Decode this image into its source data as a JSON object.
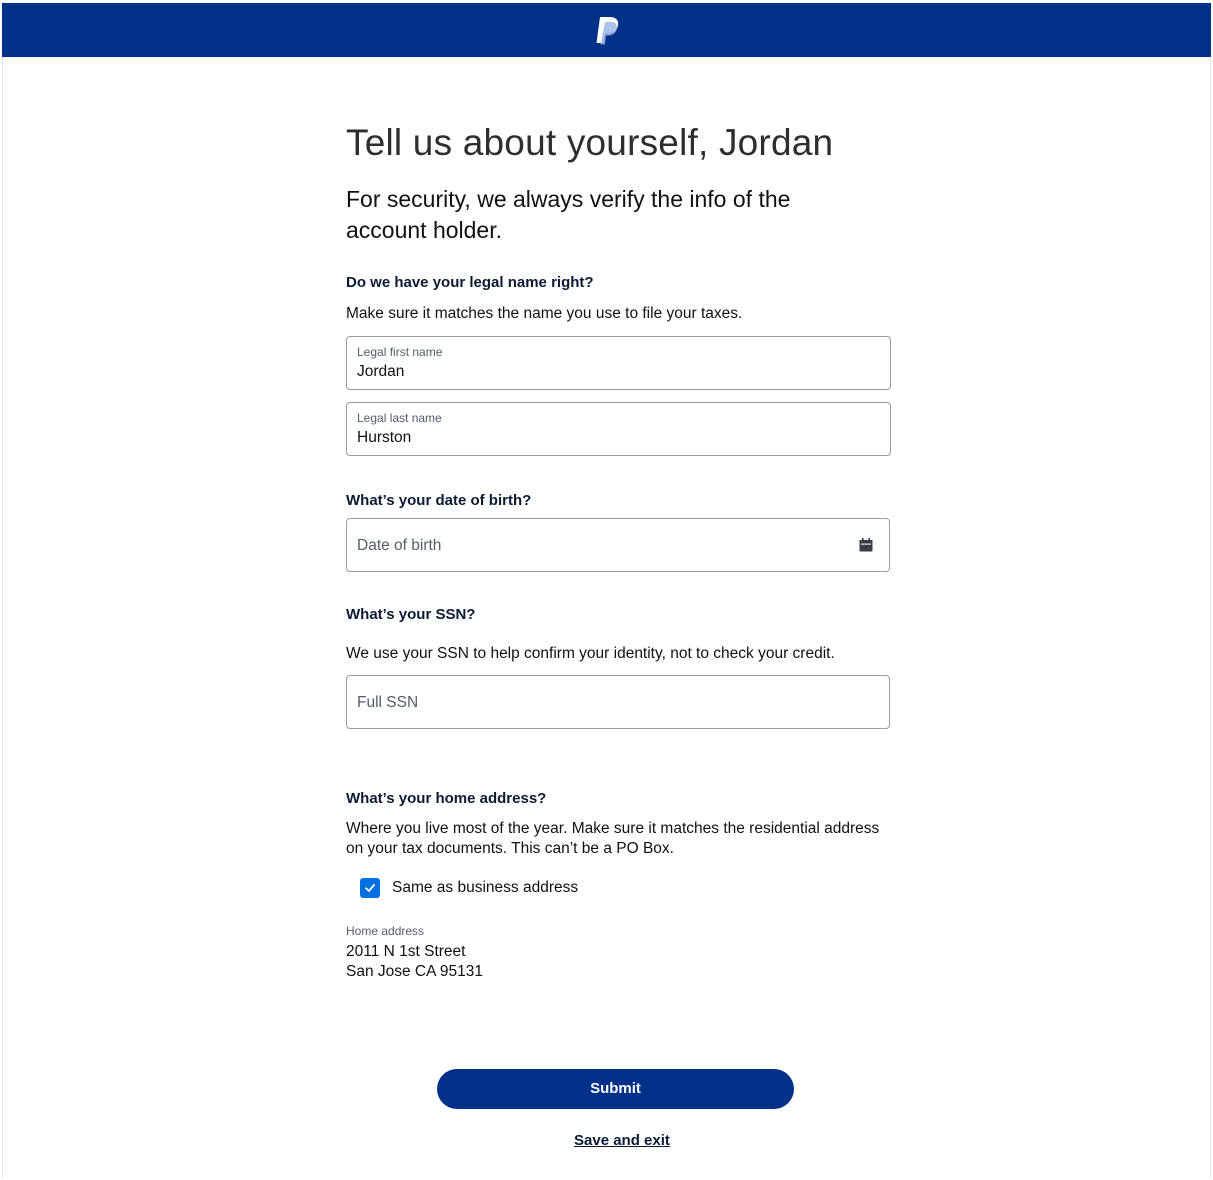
{
  "header": {
    "logo_icon": "paypal-logo-icon",
    "background_color": "#003087"
  },
  "page": {
    "title": "Tell us about yourself, Jordan",
    "subtitle": "For security, we always verify the info of the account holder."
  },
  "legal_name": {
    "heading": "Do we have your legal name right?",
    "description": "Make sure it matches the name you use to file your taxes.",
    "first_name": {
      "label": "Legal first name",
      "value": "Jordan"
    },
    "last_name": {
      "label": "Legal last name",
      "value": "Hurston"
    }
  },
  "dob": {
    "heading": "What’s your date of birth?",
    "placeholder": "Date of birth",
    "icon": "calendar-icon"
  },
  "ssn": {
    "heading": "What’s your SSN?",
    "description": "We use your SSN to help confirm your identity, not to check your credit.",
    "placeholder": "Full SSN"
  },
  "address": {
    "heading": "What’s your home address?",
    "description": "Where you live most of the year. Make sure it matches the residential address on your tax documents. This can’t be a PO Box.",
    "same_as_business_label": "Same as business address",
    "same_as_business_checked": true,
    "home_address_label": "Home address",
    "line1": "2011 N 1st Street",
    "line2": "San Jose CA 95131"
  },
  "actions": {
    "submit_label": "Submit",
    "save_exit_label": "Save and exit",
    "accent_color": "#0070e0"
  }
}
